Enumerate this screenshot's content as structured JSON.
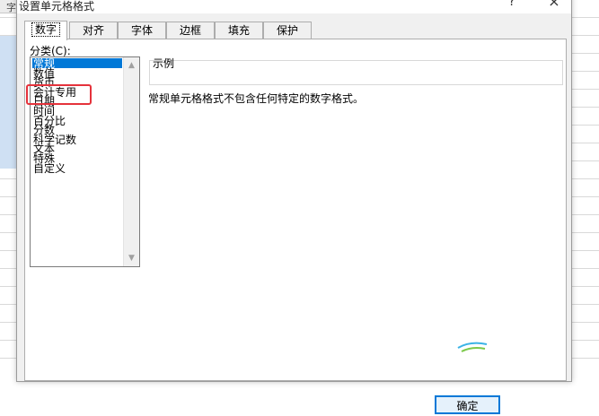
{
  "background": {
    "stub_text": "字"
  },
  "dialog": {
    "title": "设置单元格格式",
    "help_icon": "?",
    "close_icon": "×"
  },
  "tabs": [
    {
      "label": "数字",
      "active": true
    },
    {
      "label": "对齐",
      "active": false
    },
    {
      "label": "字体",
      "active": false
    },
    {
      "label": "边框",
      "active": false
    },
    {
      "label": "填充",
      "active": false
    },
    {
      "label": "保护",
      "active": false
    }
  ],
  "category": {
    "label": "分类(C):",
    "items": [
      "常规",
      "数值",
      "货币",
      "会计专用",
      "日期",
      "时间",
      "百分比",
      "分数",
      "科学记数",
      "文本",
      "特殊",
      "自定义"
    ],
    "selected": "常规",
    "highlighted": "会计专用"
  },
  "sample": {
    "label": "示例",
    "description": "常规单元格格式不包含任何特定的数字格式。"
  },
  "buttons": {
    "ok": "确定"
  },
  "colors": {
    "selection": "#0078d7",
    "highlight_border": "#e5323b",
    "dialog_bg": "#f0f0f0"
  }
}
